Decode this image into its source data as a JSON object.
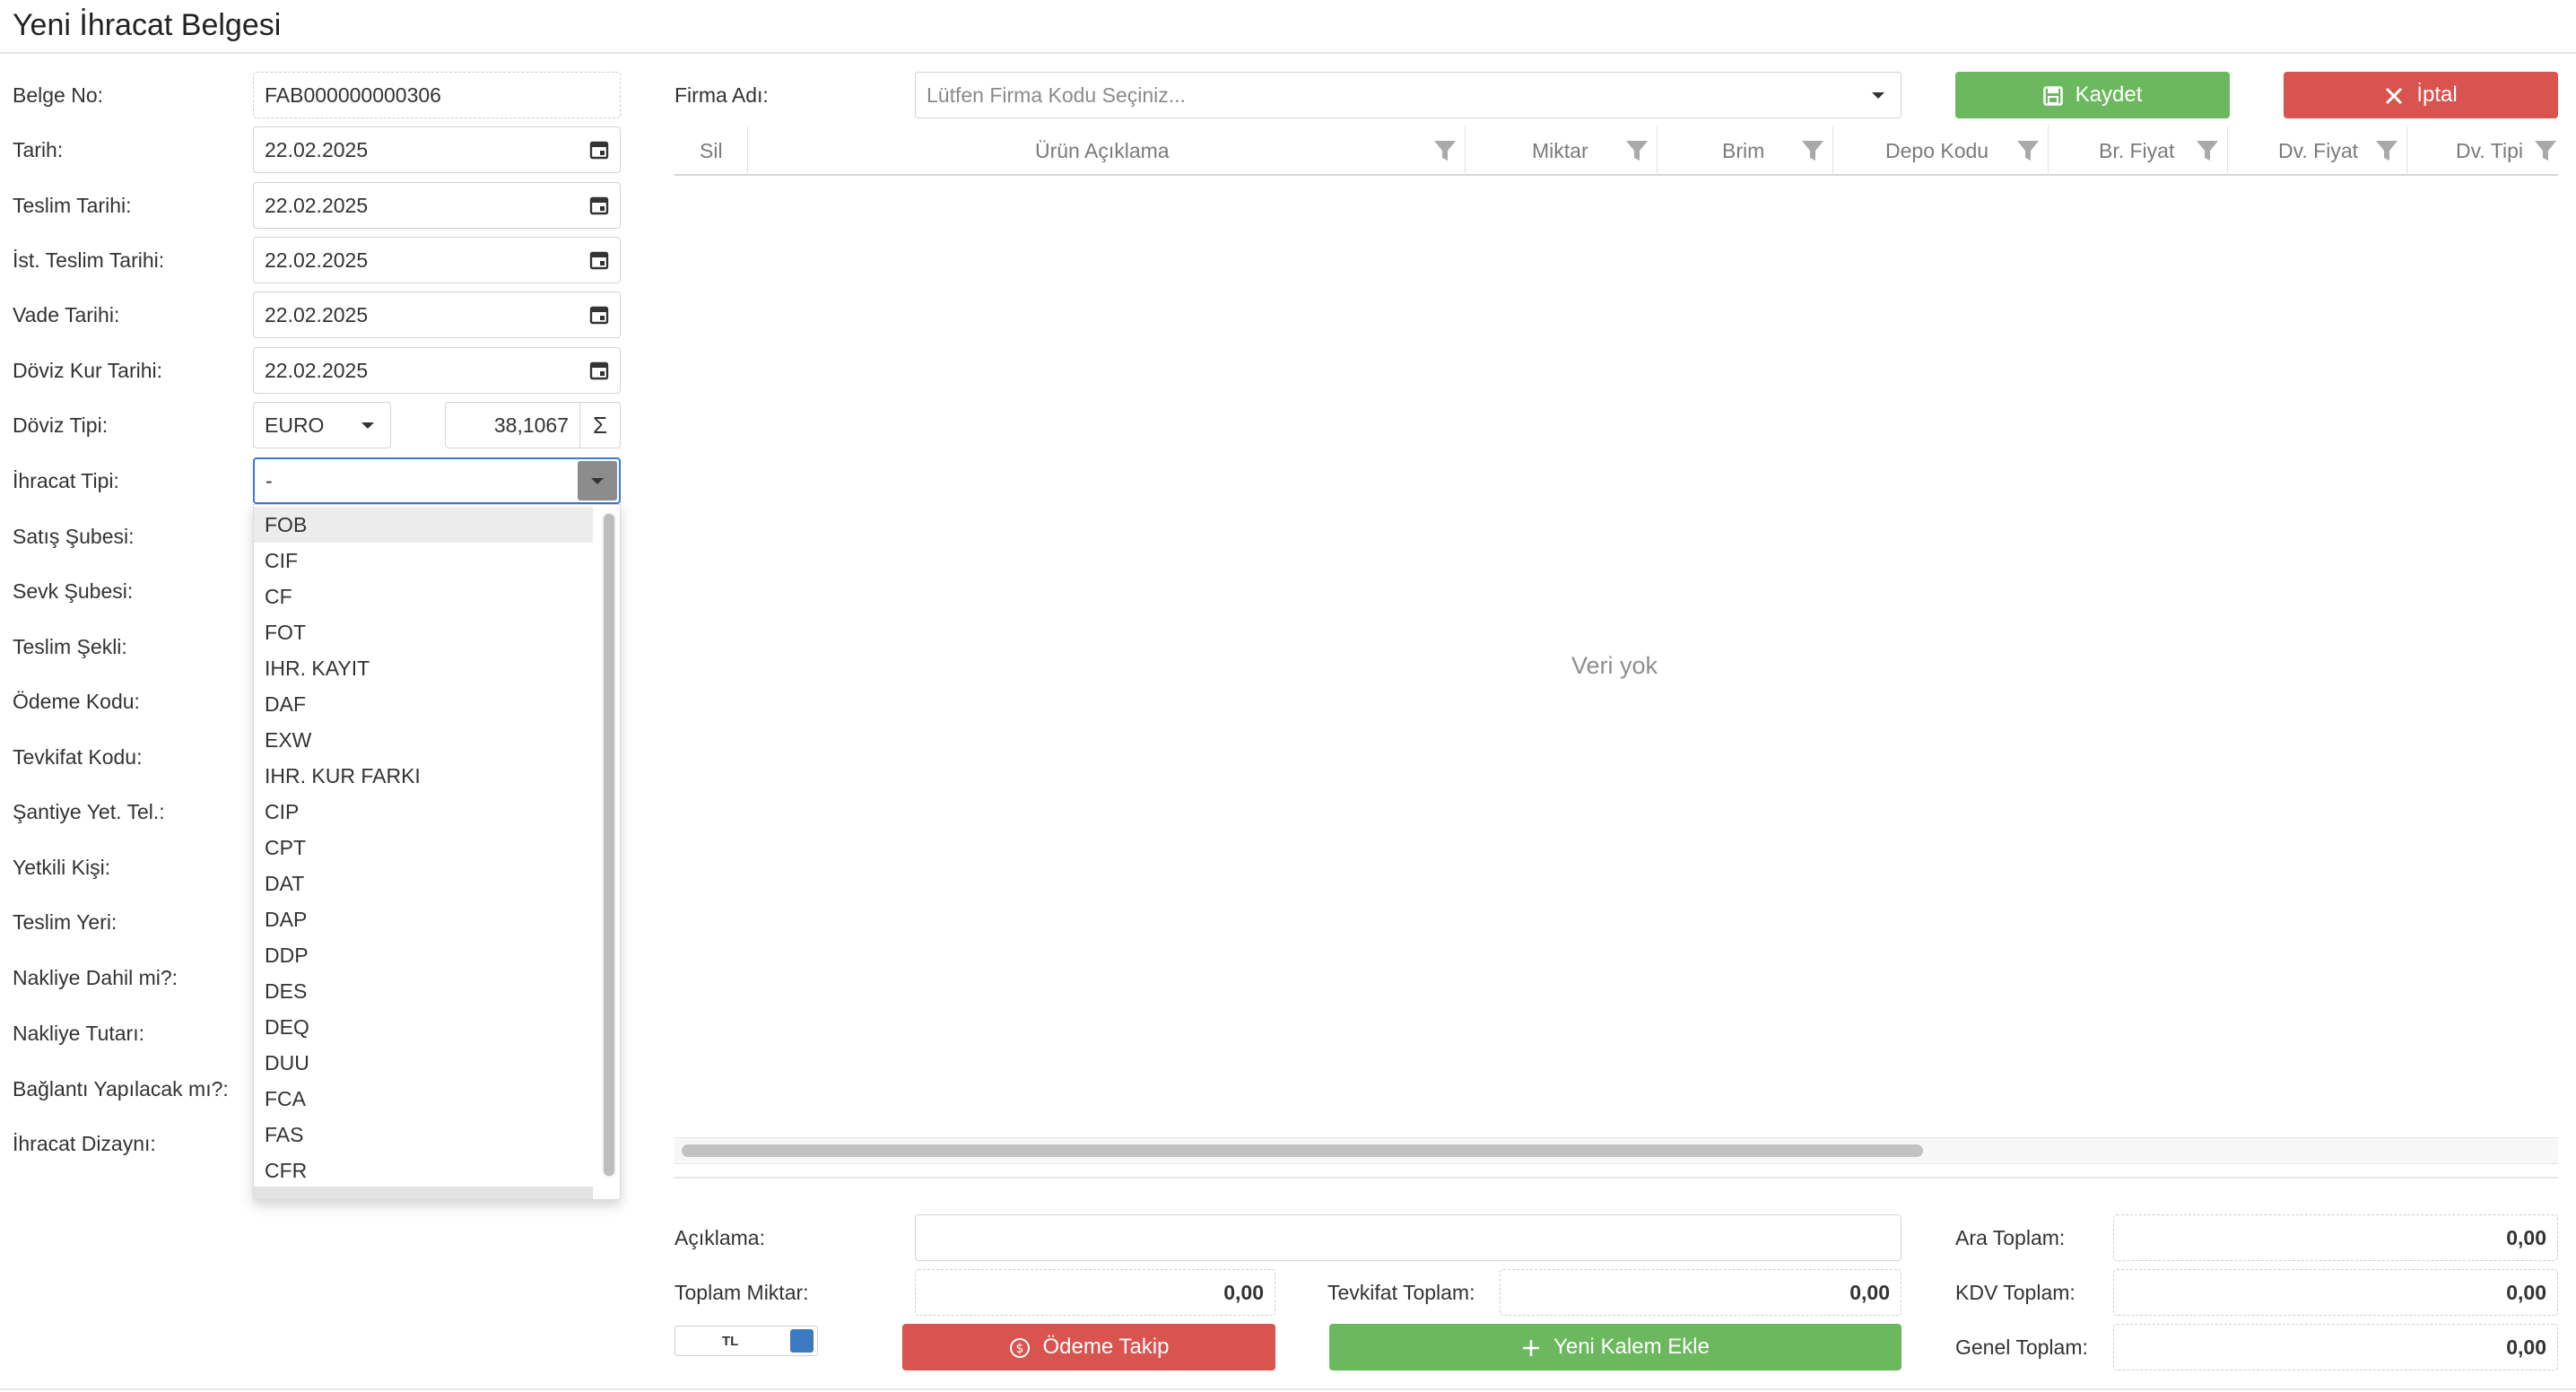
{
  "page": {
    "title": "Yeni İhracat Belgesi"
  },
  "form": {
    "belge_no": {
      "label": "Belge No:",
      "value": "FAB000000000306"
    },
    "tarih": {
      "label": "Tarih:",
      "value": "22.02.2025"
    },
    "teslim_tarihi": {
      "label": "Teslim Tarihi:",
      "value": "22.02.2025"
    },
    "ist_teslim_tarihi": {
      "label": "İst. Teslim Tarihi:",
      "value": "22.02.2025"
    },
    "vade_tarihi": {
      "label": "Vade Tarihi:",
      "value": "22.02.2025"
    },
    "doviz_kur_tarihi": {
      "label": "Döviz Kur Tarihi:",
      "value": "22.02.2025"
    },
    "doviz_tipi": {
      "label": "Döviz Tipi:",
      "value": "EURO",
      "rate": "38,1067",
      "rate_button": "Σ"
    },
    "ihracat_tipi": {
      "label": "İhracat Tipi:",
      "value": "-"
    },
    "other_labels": [
      "Satış Şubesi:",
      "Sevk Şubesi:",
      "Teslim Şekli:",
      "Ödeme Kodu:",
      "Tevkifat Kodu:",
      "Şantiye Yet. Tel.:",
      "Yetkili Kişi:",
      "Teslim Yeri:",
      "Nakliye Dahil mi?:",
      "Nakliye Tutarı:",
      "Bağlantı Yapılacak mı?:",
      "İhracat Dizaynı:"
    ]
  },
  "dropdown": {
    "options": [
      "FOB",
      "CIF",
      "CF",
      "FOT",
      "IHR. KAYIT",
      "DAF",
      "EXW",
      "IHR. KUR FARKI",
      "CIP",
      "CPT",
      "DAT",
      "DAP",
      "DDP",
      "DES",
      "DEQ",
      "DUU",
      "FCA",
      "FAS",
      "CFR"
    ],
    "highlighted": "FOB"
  },
  "firma": {
    "label": "Firma Adı:",
    "placeholder": "Lütfen Firma Kodu Seçiniz..."
  },
  "toolbar": {
    "save_label": "Kaydet",
    "cancel_label": "İptal",
    "save_color": "#6cb85e",
    "cancel_color": "#d9534f"
  },
  "grid": {
    "columns": [
      "Sil",
      "Ürün Açıklama",
      "Miktar",
      "Brim",
      "Depo Kodu",
      "Br. Fiyat",
      "Dv. Fiyat",
      "Dv. Tipi"
    ],
    "empty_text": "Veri yok"
  },
  "bottom": {
    "aciklama_label": "Açıklama:",
    "toplam_miktar_label": "Toplam Miktar:",
    "toplam_miktar_value": "0,00",
    "tevkifat_toplam_label": "Tevkifat Toplam:",
    "tevkifat_toplam_value": "0,00",
    "ara_toplam_label": "Ara Toplam:",
    "ara_toplam_value": "0,00",
    "kdv_toplam_label": "KDV Toplam:",
    "kdv_toplam_value": "0,00",
    "genel_toplam_label": "Genel Toplam:",
    "genel_toplam_value": "0,00",
    "currency_toggle_label": "TL",
    "odeme_takip_label": "Ödeme Takip",
    "yeni_kalem_label": "Yeni Kalem Ekle"
  }
}
